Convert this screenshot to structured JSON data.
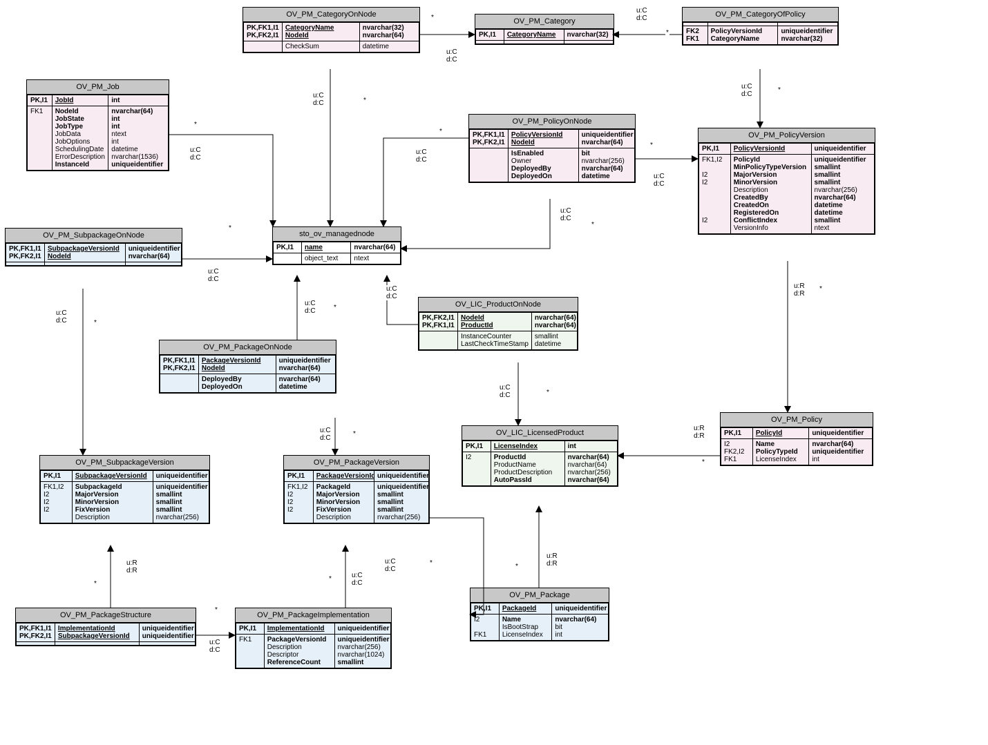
{
  "entities": {
    "CategoryOnNode": {
      "title": "OV_PM_CategoryOnNode",
      "rows": [
        {
          "k": "PK,FK1,I1\nPK,FK2,I1",
          "n": "CategoryName\nNodeId",
          "t": "nvarchar(32)\nnvarchar(64)",
          "pk": true,
          "ul": true
        },
        {
          "k": "",
          "n": "CheckSum",
          "t": "datetime"
        }
      ]
    },
    "Category": {
      "title": "OV_PM_Category",
      "rows": [
        {
          "k": "PK,I1",
          "n": "CategoryName",
          "t": "nvarchar(32)",
          "pk": true,
          "ul": true
        },
        {
          "k": "",
          "n": "",
          "t": ""
        }
      ]
    },
    "CategoryOfPolicy": {
      "title": "OV_PM_CategoryOfPolicy",
      "rows": [
        {
          "k": "",
          "n": "",
          "t": ""
        },
        {
          "k": "FK2\nFK1",
          "n": "PolicyVersionId\nCategoryName",
          "t": "uniqueidentifier\nnvarchar(32)",
          "pk": true
        }
      ]
    },
    "Job": {
      "title": "OV_PM_Job",
      "rows": [
        {
          "k": "PK,I1",
          "n": "JobId",
          "t": "int",
          "pk": true,
          "ul": true
        },
        {
          "k": "FK1",
          "n": "NodeId\nJobState\nJobType\nJobData\nJobOptions\nSchedulingDate\nErrorDescription\nInstanceId",
          "t": "nvarchar(64)\nint\nint\nntext\nint\ndatetime\nnvarchar(1536)\nuniqueidentifier",
          "pk": false,
          "bold": "NodeId,JobState,JobType,InstanceId"
        }
      ]
    },
    "PolicyOnNode": {
      "title": "OV_PM_PolicyOnNode",
      "rows": [
        {
          "k": "PK,FK1,I1\nPK,FK2,I1",
          "n": "PolicyVersionId\nNodeId",
          "t": "uniqueidentifier\nnvarchar(64)",
          "pk": true,
          "ul": true
        },
        {
          "k": "",
          "n": "IsEnabled\nOwner\nDeployedBy\nDeployedOn",
          "t": "bit\nnvarchar(256)\nnvarchar(64)\ndatetime",
          "bold": "IsEnabled,DeployedBy,DeployedOn"
        }
      ]
    },
    "PolicyVersion": {
      "title": "OV_PM_PolicyVersion",
      "rows": [
        {
          "k": "PK,I1",
          "n": "PolicyVersionId",
          "t": "uniqueidentifier",
          "pk": true,
          "ul": true
        },
        {
          "k": "FK1,I2\n\nI2\nI2\n\n\n\n\nI2",
          "n": "PolicyId\nMinPolicyTypeVersion\nMajorVersion\nMinorVersion\nDescription\nCreatedBy\nCreatedOn\nRegisteredOn\nConflictIndex\nVersionInfo",
          "t": "uniqueidentifier\nsmallint\nsmallint\nsmallint\nnvarchar(256)\nnvarchar(64)\ndatetime\ndatetime\nsmallint\nntext",
          "bold": "PolicyId,MinPolicyTypeVersion,MajorVersion,MinorVersion,CreatedBy,CreatedOn,RegisteredOn,ConflictIndex"
        }
      ]
    },
    "SubpackageOnNode": {
      "title": "OV_PM_SubpackageOnNode",
      "rows": [
        {
          "k": "PK,FK1,I1\nPK,FK2,I1",
          "n": "SubpackageVersionId\nNodeId",
          "t": "uniqueidentifier\nnvarchar(64)",
          "pk": true,
          "ul": true
        },
        {
          "k": "",
          "n": "",
          "t": ""
        }
      ]
    },
    "ManagedNode": {
      "title": "sto_ov_managednode",
      "rows": [
        {
          "k": "PK,I1",
          "n": "name",
          "t": "nvarchar(64)",
          "pk": true,
          "ul": true
        },
        {
          "k": "",
          "n": "object_text",
          "t": "ntext"
        }
      ]
    },
    "ProductOnNode": {
      "title": "OV_LIC_ProductOnNode",
      "rows": [
        {
          "k": "PK,FK2,I1\nPK,FK1,I1",
          "n": "NodeId\nProductId",
          "t": "nvarchar(64)\nnvarchar(64)",
          "pk": true,
          "ul": true
        },
        {
          "k": "",
          "n": "InstanceCounter\nLastCheckTimeStamp",
          "t": "smallint\ndatetime"
        }
      ]
    },
    "PackageOnNode": {
      "title": "OV_PM_PackageOnNode",
      "rows": [
        {
          "k": "PK,FK1,I1\nPK,FK2,I1",
          "n": "PackageVersionId\nNodeId",
          "t": "uniqueidentifier\nnvarchar(64)",
          "pk": true,
          "ul": true
        },
        {
          "k": "",
          "n": "DeployedBy\nDeployedOn",
          "t": "nvarchar(64)\ndatetime",
          "bold": "DeployedBy,DeployedOn"
        }
      ]
    },
    "LicensedProduct": {
      "title": "OV_LIC_LicensedProduct",
      "rows": [
        {
          "k": "PK,I1",
          "n": "LicenseIndex",
          "t": "int",
          "pk": true,
          "ul": true
        },
        {
          "k": "I2",
          "n": "ProductId\nProductName\nProductDescription\nAutoPassId",
          "t": "nvarchar(64)\nnvarchar(64)\nnvarchar(256)\nnvarchar(64)",
          "bold": "ProductId,AutoPassId"
        }
      ]
    },
    "Policy": {
      "title": "OV_PM_Policy",
      "rows": [
        {
          "k": "PK,I1",
          "n": "PolicyId",
          "t": "uniqueidentifier",
          "pk": true,
          "ul": true
        },
        {
          "k": "I2\nFK2,I2\nFK1",
          "n": "Name\nPolicyTypeId\nLicenseIndex",
          "t": "nvarchar(64)\nuniqueidentifier\nint",
          "bold": "Name,PolicyTypeId"
        }
      ]
    },
    "SubpackageVersion": {
      "title": "OV_PM_SubpackageVersion",
      "rows": [
        {
          "k": "PK,I1",
          "n": "SubpackageVersionId",
          "t": "uniqueidentifier",
          "pk": true,
          "ul": true
        },
        {
          "k": "FK1,I2\nI2\nI2\nI2",
          "n": "SubpackageId\nMajorVersion\nMinorVersion\nFixVersion\nDescription",
          "t": "uniqueidentifier\nsmallint\nsmallint\nsmallint\nnvarchar(256)",
          "bold": "SubpackageId,MajorVersion,MinorVersion,FixVersion"
        }
      ]
    },
    "PackageVersion": {
      "title": "OV_PM_PackageVersion",
      "rows": [
        {
          "k": "PK,I1",
          "n": "PackageVersionId",
          "t": "uniqueidentifier",
          "pk": true,
          "ul": true
        },
        {
          "k": "FK1,I2\nI2\nI2\nI2",
          "n": "PackageId\nMajorVersion\nMinorVersion\nFixVersion\nDescription",
          "t": "uniqueidentifier\nsmallint\nsmallint\nsmallint\nnvarchar(256)",
          "bold": "PackageId,MajorVersion,MinorVersion,FixVersion"
        }
      ]
    },
    "Package": {
      "title": "OV_PM_Package",
      "rows": [
        {
          "k": "PK,I1",
          "n": "PackageId",
          "t": "uniqueidentifier",
          "pk": true,
          "ul": true
        },
        {
          "k": "I2\n\nFK1",
          "n": "Name\nIsBootStrap\nLicenseIndex",
          "t": "nvarchar(64)\nbit\nint",
          "bold": "Name"
        }
      ]
    },
    "PackageStructure": {
      "title": "OV_PM_PackageStructure",
      "rows": [
        {
          "k": "PK,FK1,I1\nPK,FK2,I1",
          "n": "ImplementationId\nSubpackageVersionId",
          "t": "uniqueidentifier\nuniqueidentifier",
          "pk": true,
          "ul": true
        },
        {
          "k": "",
          "n": "",
          "t": ""
        }
      ]
    },
    "PackageImplementation": {
      "title": "OV_PM_PackageImplementation",
      "rows": [
        {
          "k": "PK,I1",
          "n": "ImplementationId",
          "t": "uniqueidentifier",
          "pk": true,
          "ul": true
        },
        {
          "k": "FK1",
          "n": "PackageVersionId\nDescription\nDescriptor\nReferenceCount",
          "t": "uniqueidentifier\nnvarchar(256)\nnvarchar(1024)\nsmallint",
          "bold": "PackageVersionId,ReferenceCount"
        }
      ]
    }
  },
  "labels": {
    "ucdc": "u:C\nd:C",
    "urdur": "u:R\nd:R",
    "star": "*"
  }
}
